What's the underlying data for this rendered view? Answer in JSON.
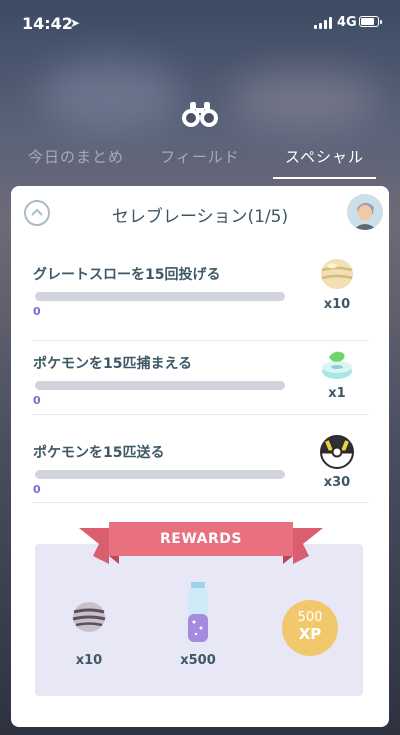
{
  "status_bar": {
    "time": "14:42",
    "network": "4G"
  },
  "tabs": [
    {
      "label": "今日のまとめ"
    },
    {
      "label": "フィールド"
    },
    {
      "label": "スペシャル"
    }
  ],
  "active_tab": "スペシャル",
  "research": {
    "title": "セレブレーション(1/5)",
    "tasks": [
      {
        "label": "グレートスローを15回投げる",
        "progress": "0",
        "progress_fraction": 0,
        "reward_icon": "nanab-berry-icon",
        "reward_qty": "x10"
      },
      {
        "label": "ポケモンを15匹捕まえる",
        "progress": "0",
        "progress_fraction": 0,
        "reward_icon": "incense-icon",
        "reward_qty": "x1"
      },
      {
        "label": "ポケモンを15匹送る",
        "progress": "0",
        "progress_fraction": 0,
        "reward_icon": "ultra-ball-icon",
        "reward_qty": "x30"
      }
    ]
  },
  "rewards": {
    "title": "REWARDS",
    "items": [
      {
        "icon": "silver-berry-icon",
        "qty": "x10"
      },
      {
        "icon": "stardust-icon",
        "qty": "x500"
      },
      {
        "icon": "xp-badge",
        "amount": "500",
        "label": "XP"
      }
    ]
  },
  "colors": {
    "accent_purple": "#8e7bd6",
    "ribbon_pink": "#e8707f",
    "xp_gold": "#f2c86c",
    "text_slate": "#3e5866"
  }
}
